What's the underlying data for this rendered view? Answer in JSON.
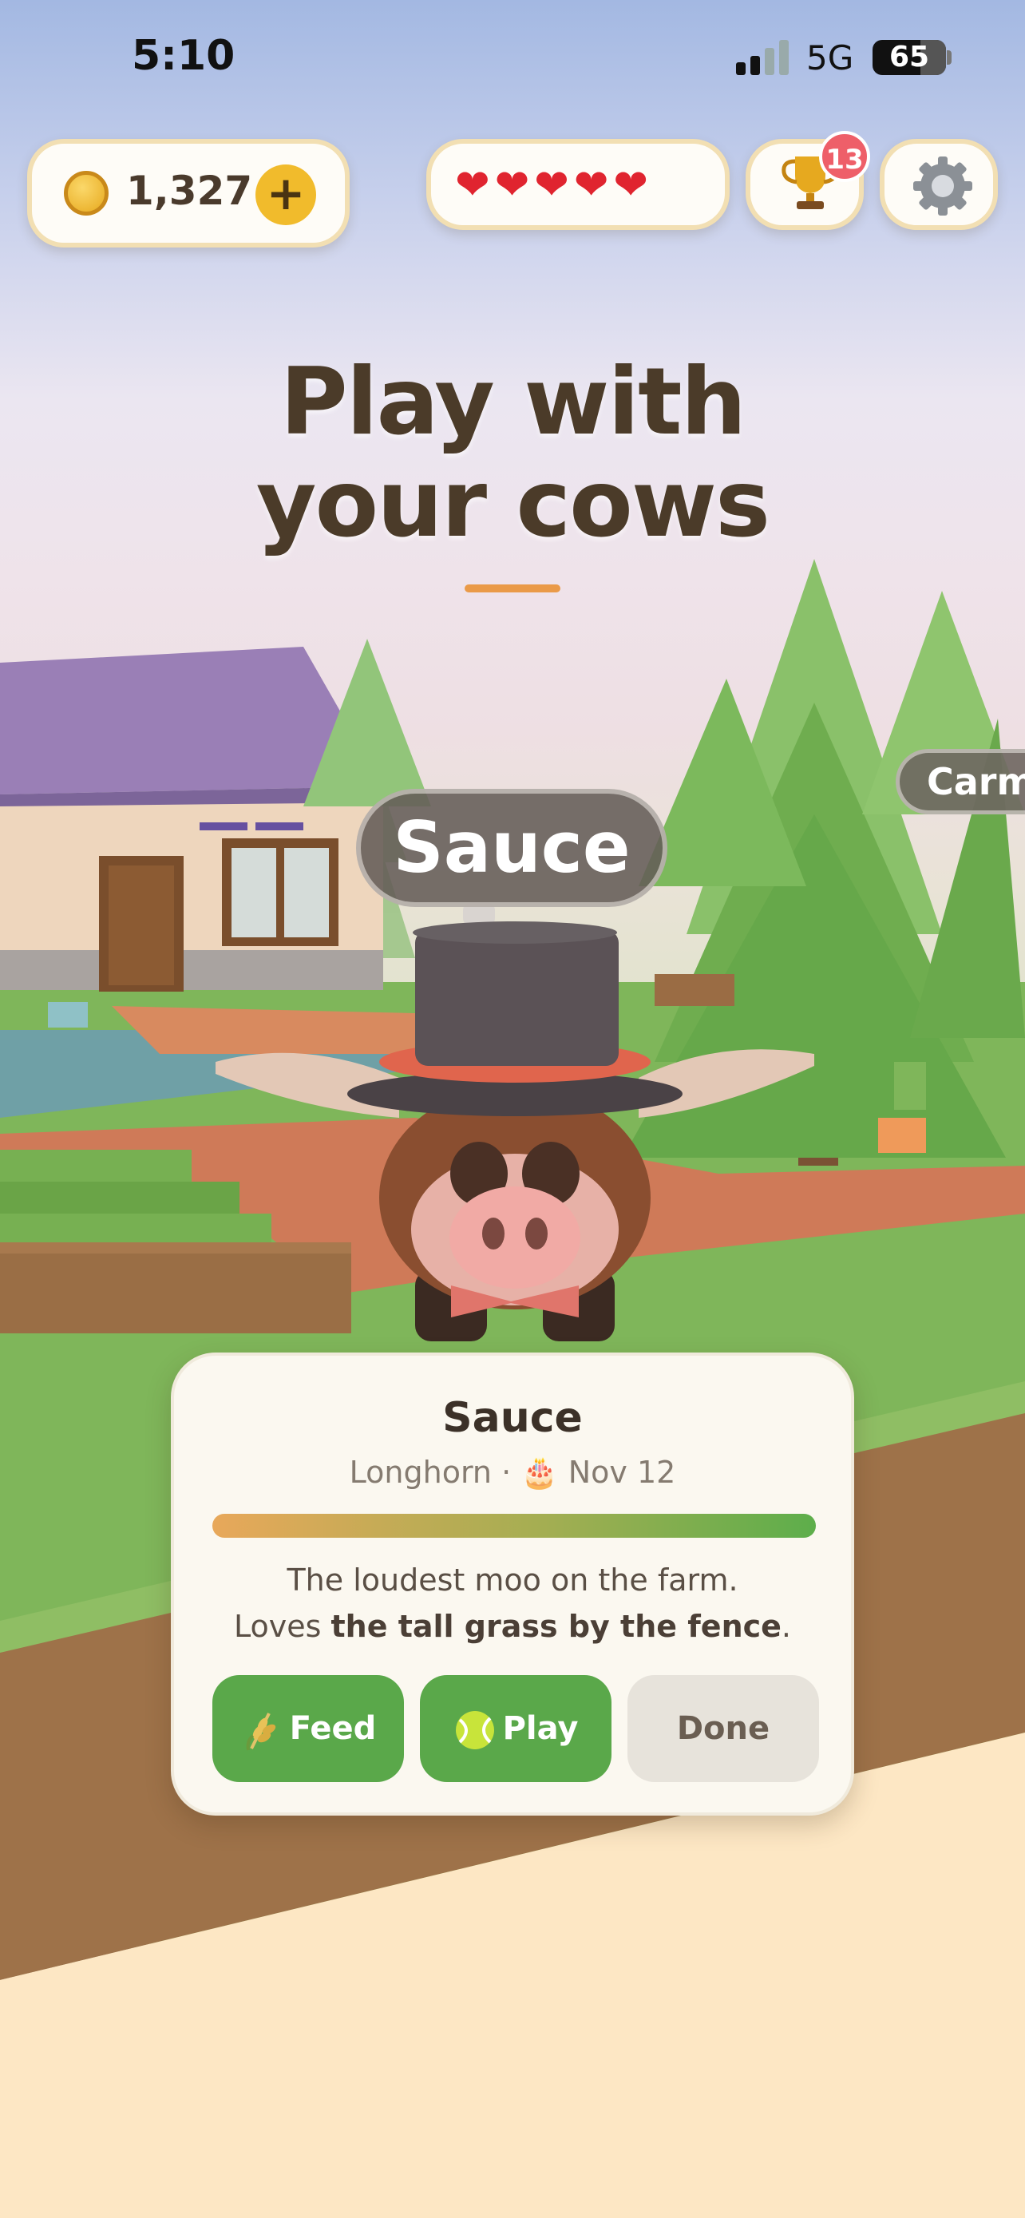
{
  "status_bar": {
    "time": "5:10",
    "network": "5G",
    "battery": "65"
  },
  "hud": {
    "coins": "1,327",
    "add_coins_label": "+",
    "hearts": "❤❤❤❤❤",
    "trophy_badge": "13"
  },
  "title": {
    "line1": "Play with",
    "line2": "your cows"
  },
  "scene": {
    "current_cow_tag": "Sauce",
    "next_cow_tag": "Carmi"
  },
  "card": {
    "name": "Sauce",
    "breed": "Longhorn",
    "separator": "·",
    "birthday_icon": "🎂",
    "birthday": "Nov 12",
    "desc_line1": "The loudest moo on the farm.",
    "desc_prefix": "Loves ",
    "desc_bold": "the tall grass by the fence",
    "desc_suffix": ".",
    "buttons": {
      "feed": "Feed",
      "play": "Play",
      "done": "Done"
    },
    "colors": {
      "primary": "#5aa84a",
      "secondary": "#e7e3db"
    }
  }
}
